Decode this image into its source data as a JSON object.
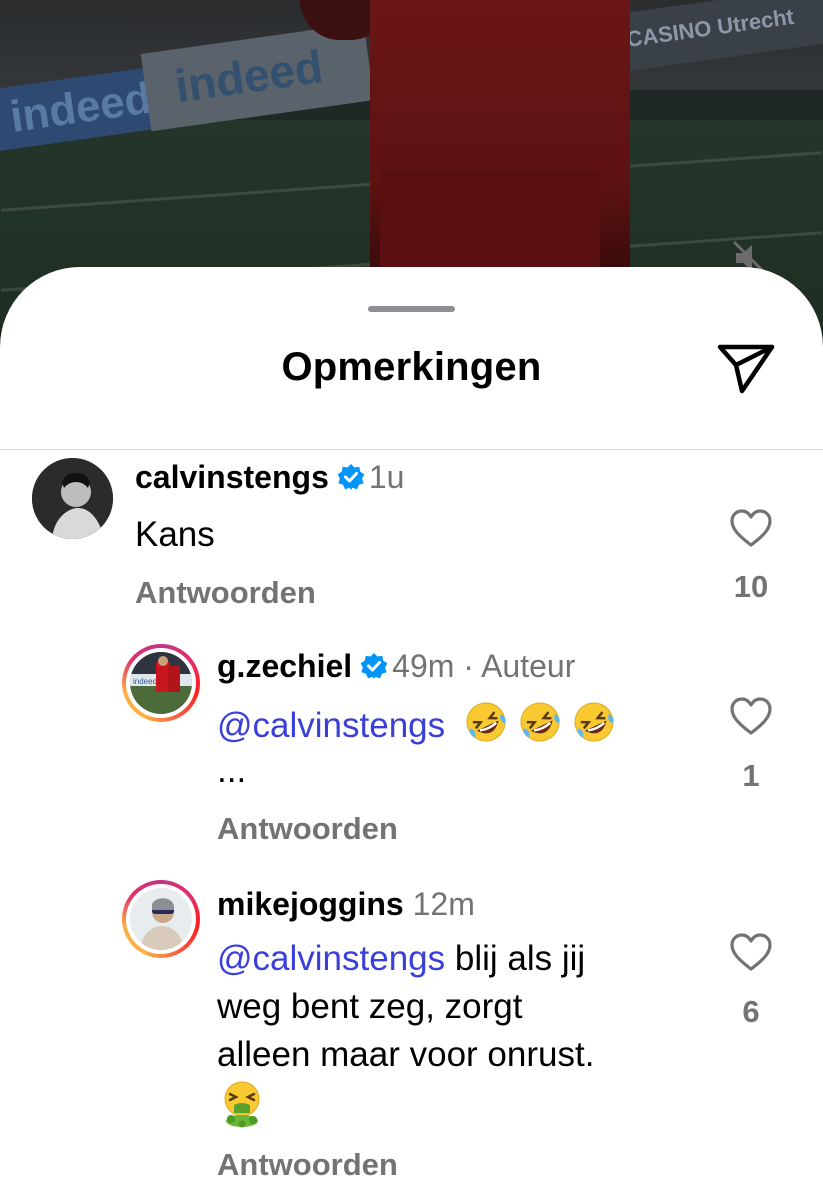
{
  "video": {
    "boards": [
      "indeed",
      "indeed",
      "CASINO Utrecht"
    ]
  },
  "sheet": {
    "title": "Opmerkingen"
  },
  "comments": [
    {
      "username": "calvinstengs",
      "verified": true,
      "time": "1u",
      "text": "Kans",
      "reply_label": "Antwoorden",
      "likes": "10"
    },
    {
      "username": "g.zechiel",
      "verified": true,
      "time": "49m",
      "separator": "·",
      "author_label": "Auteur",
      "mention": "@calvinstengs",
      "ellipsis": "...",
      "reply_label": "Antwoorden",
      "likes": "1",
      "emojis": [
        "rolling-on-floor-laughing",
        "rolling-on-floor-laughing",
        "rolling-on-floor-laughing"
      ]
    },
    {
      "username": "mikejoggins",
      "verified": false,
      "time": "12m",
      "mention": "@calvinstengs",
      "text_line1": " blij als jij",
      "text_line2": "weg bent zeg, zorgt",
      "text_line3": "alleen maar voor onrust.",
      "reply_label": "Antwoorden",
      "likes": "6",
      "emojis": [
        "nauseated-vomiting"
      ]
    }
  ],
  "colors": {
    "mention": "#3a3fd9",
    "secondary_text": "#737373",
    "verified_badge": "#0095f6"
  }
}
